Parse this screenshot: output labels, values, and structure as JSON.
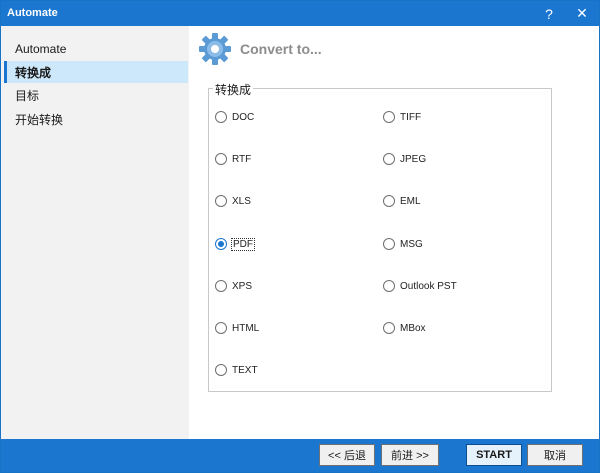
{
  "window": {
    "title": "Automate",
    "help_label": "?",
    "close_label": "✕"
  },
  "sidebar": {
    "items": [
      {
        "label": "Automate"
      },
      {
        "label": "转换成"
      },
      {
        "label": "目标"
      },
      {
        "label": "开始转换"
      }
    ]
  },
  "header": {
    "title": "Convert to..."
  },
  "group": {
    "legend": "转换成",
    "selected": "PDF",
    "options_left": [
      "DOC",
      "RTF",
      "XLS",
      "PDF",
      "XPS",
      "HTML",
      "TEXT"
    ],
    "options_right": [
      "TIFF",
      "JPEG",
      "EML",
      "MSG",
      "Outlook PST",
      "MBox"
    ]
  },
  "footer": {
    "back_label": "<< 后退",
    "next_label": "前进 >>",
    "start_label": "START",
    "cancel_label": "取消"
  },
  "colors": {
    "accent": "#1a76cf",
    "sidebar_bg": "#f2f2f2",
    "selected_bg": "#cde8fb",
    "heading": "#8c8c8c"
  },
  "icons": {
    "header": "gear-icon"
  }
}
